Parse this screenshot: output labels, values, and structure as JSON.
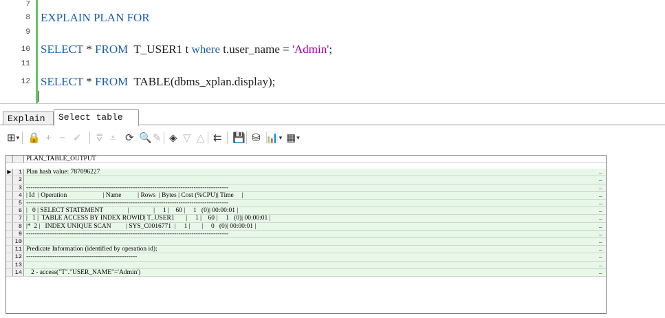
{
  "editor": {
    "lines": [
      {
        "num": "7",
        "tokens": []
      },
      {
        "num": "8",
        "tokens": [
          {
            "t": "EXPLAIN PLAN FOR",
            "c": "kw"
          }
        ]
      },
      {
        "num": "9",
        "tokens": []
      },
      {
        "num": "10",
        "tokens": [
          {
            "t": "SELECT",
            "c": "kw"
          },
          {
            "t": " * ",
            "c": "fn"
          },
          {
            "t": "FROM",
            "c": "kw"
          },
          {
            "t": "  T_USER1 t ",
            "c": "fn"
          },
          {
            "t": "where",
            "c": "kw"
          },
          {
            "t": " t.user_name = ",
            "c": "fn"
          },
          {
            "t": "'Admin'",
            "c": "str"
          },
          {
            "t": ";",
            "c": "fn"
          }
        ]
      },
      {
        "num": "11",
        "tokens": []
      },
      {
        "num": "12",
        "tokens": [
          {
            "t": "SELECT",
            "c": "kw"
          },
          {
            "t": " * ",
            "c": "fn"
          },
          {
            "t": "FROM",
            "c": "kw"
          },
          {
            "t": "  TABLE(dbms_xplan.display);",
            "c": "fn"
          }
        ]
      }
    ]
  },
  "tabs": {
    "explain": "Explain",
    "select_table": "Select table"
  },
  "toolbar": {
    "icons": [
      {
        "name": "grid-options-icon",
        "glyph": "⊞",
        "dd": true,
        "dis": false
      },
      {
        "name": "lock-icon",
        "glyph": "🔒",
        "dis": false
      },
      {
        "name": "add-record-icon",
        "glyph": "+",
        "dis": true
      },
      {
        "name": "delete-record-icon",
        "glyph": "−",
        "dis": true
      },
      {
        "name": "post-changes-icon",
        "glyph": "✓",
        "dis": true
      },
      {
        "name": "fetch-next-icon",
        "glyph": "⩢",
        "dis": true
      },
      {
        "name": "fetch-last-icon",
        "glyph": "⩡",
        "dis": true
      },
      {
        "name": "refresh-icon",
        "glyph": "⟳",
        "dis": false
      },
      {
        "name": "find-icon",
        "glyph": "🔍",
        "dis": false
      },
      {
        "name": "clear-icon",
        "glyph": "✎",
        "dis": true
      },
      {
        "name": "query-by-example-icon",
        "glyph": "◈",
        "dis": false
      },
      {
        "name": "next-record-icon",
        "glyph": "▽",
        "dis": true
      },
      {
        "name": "previous-record-icon",
        "glyph": "△",
        "dis": true
      },
      {
        "name": "single-record-view-icon",
        "glyph": "⇇",
        "dis": false
      },
      {
        "name": "save-icon",
        "glyph": "💾",
        "dis": false
      },
      {
        "name": "export-icon",
        "glyph": "⛁",
        "dis": false
      },
      {
        "name": "chart-icon",
        "glyph": "📊",
        "dd": true,
        "dis": false
      },
      {
        "name": "table-icon",
        "glyph": "▦",
        "dd": true,
        "dis": false
      }
    ]
  },
  "grid": {
    "header": "PLAN_TABLE_OUTPUT",
    "rows": [
      "Plan hash value: 787096227",
      "",
      "---------------------------------------------------------------------------------------------",
      "| Id  | Operation                      | Name          | Rows  | Bytes | Cost (%CPU)| Time     |",
      "---------------------------------------------------------------------------------------------",
      "|   0 | SELECT STATEMENT               |               |     1 |    60 |     1   (0)| 00:00:01 |",
      "|   1 |  TABLE ACCESS BY INDEX ROWID| T_USER1       |     1 |    60 |     1   (0)| 00:00:01 |",
      "|*  2 |   INDEX UNIQUE SCAN         | SYS_C0016771  |     1 |       |     0   (0)| 00:00:01 |",
      "---------------------------------------------------------------------------------------------",
      "",
      "Predicate Information (identified by operation id):",
      "---------------------------------------------------",
      "",
      "   2 - access(\"T\".\"USER_NAME\"='Admin')"
    ],
    "ellipsis": "..."
  }
}
